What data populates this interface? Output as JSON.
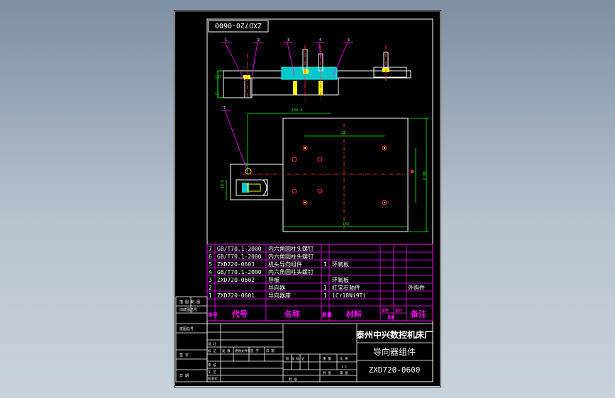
{
  "title_box": "ZXD720-0600",
  "balloons": [
    "1",
    "2",
    "3",
    "4",
    "5",
    "6",
    "7"
  ],
  "dims": {
    "d_117": "117",
    "d_15": "15",
    "d_22": "22",
    "d_189": "189",
    "d_103_4": "103.4",
    "d_88_2": "88.2",
    "d_18_6": "18.6",
    "d_8": "8"
  },
  "bom": {
    "rows": [
      {
        "no": "7",
        "code": "GB/T70.1-2000",
        "name": "内六角圆柱头螺钉",
        "qty": "",
        "mat": "",
        "note": ""
      },
      {
        "no": "6",
        "code": "GB/T70.1-2000",
        "name": "内六角圆柱头螺钉",
        "qty": "",
        "mat": "",
        "note": ""
      },
      {
        "no": "5",
        "code": "ZXD720-0603",
        "name": "机头导向组件",
        "qty": "1",
        "mat": "环氧板",
        "note": ""
      },
      {
        "no": "4",
        "code": "GB/T70.1-2000",
        "name": "内六角圆柱头螺钉",
        "qty": "",
        "mat": "",
        "note": ""
      },
      {
        "no": "3",
        "code": "ZXD720-0602",
        "name": "导板",
        "qty": "",
        "mat": "环氧板",
        "note": ""
      },
      {
        "no": "2",
        "code": "",
        "name": "导向器",
        "qty": "1",
        "mat": "红宝石轴件",
        "note": "外购件"
      },
      {
        "no": "1",
        "code": "ZXD720-0601",
        "name": "导向器座",
        "qty": "1",
        "mat": "1Cr18Ni9Ti",
        "note": ""
      }
    ],
    "header": {
      "no": "序号",
      "code": "代号",
      "name": "名称",
      "qty": "数量",
      "mat": "材料",
      "single": "单件",
      "total": "总计",
      "weight": "重量",
      "note": "备注"
    }
  },
  "left_strip": {
    "top": "描 图 制 图",
    "mid": "旧底图总号",
    "bottom": "底图总号",
    "sign": "签 字",
    "date": "日 期"
  },
  "title_block": {
    "company": "泰州中兴数控机床厂",
    "part_name": "导向器组件",
    "drawing_no": "ZXD720-0600",
    "labels": [
      "标 记",
      "处 数",
      "更改文件号",
      "签 字",
      "日 期",
      "设 计",
      "审 核",
      "工 艺",
      "标准化",
      "批 准",
      "阶 段 标 记",
      "重 量",
      "比 例",
      "共 张",
      "第 张"
    ],
    "scale": "1:1"
  }
}
